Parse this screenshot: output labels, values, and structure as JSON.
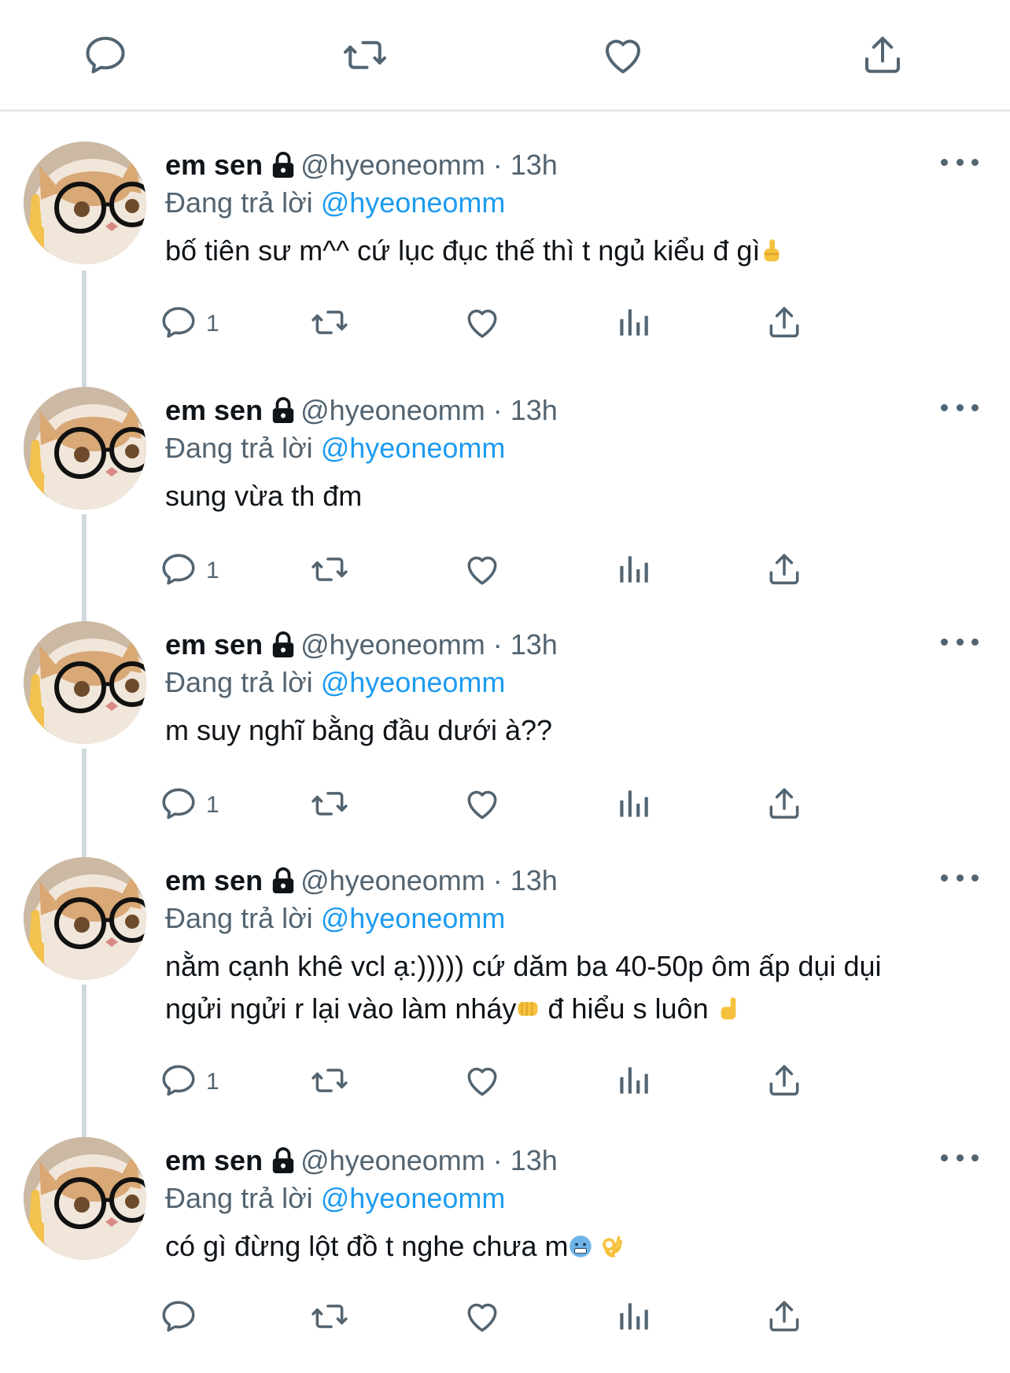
{
  "colors": {
    "text": "#0f1419",
    "secondary": "#536471",
    "accent": "#1d9bf0",
    "divider": "#e6e9ec",
    "thread_line": "#cfd9de"
  },
  "top_actions": [
    {
      "icon": "reply-icon"
    },
    {
      "icon": "retweet-icon"
    },
    {
      "icon": "like-icon"
    },
    {
      "icon": "share-icon"
    }
  ],
  "tweets": [
    {
      "name": "em sen",
      "handle": "@hyeoneomm",
      "separator": "·",
      "time": "13h",
      "replying_label": "Đang trả lời",
      "replying_to": "@hyeoneomm",
      "text_lines": [
        "bố tiên sư m^^ cứ lục đục thế thì t ngủ kiểu đ gì"
      ],
      "emojis": [
        "middle-finger-emoji"
      ],
      "reply_count": "1"
    },
    {
      "name": "em sen",
      "handle": "@hyeoneomm",
      "separator": "·",
      "time": "13h",
      "replying_label": "Đang trả lời",
      "replying_to": "@hyeoneomm",
      "text_lines": [
        "sung vừa th đm"
      ],
      "reply_count": "1"
    },
    {
      "name": "em sen",
      "handle": "@hyeoneomm",
      "separator": "·",
      "time": "13h",
      "replying_label": "Đang trả lời",
      "replying_to": "@hyeoneomm",
      "text_lines": [
        "m suy nghĩ bằng đầu dưới à??"
      ],
      "reply_count": "1"
    },
    {
      "name": "em sen",
      "handle": "@hyeoneomm",
      "separator": "·",
      "time": "13h",
      "replying_label": "Đang trả lời",
      "replying_to": "@hyeoneomm",
      "text_lines": [
        "nằm cạnh khê vcl ạ:))))) cứ dăm ba 40-50p ôm ấp dụi dụi",
        "ngửi ngửi r lại vào làm nháy",
        "đ hiểu s luôn"
      ],
      "emojis": [
        "punch-emoji",
        "pinky-finger-emoji"
      ],
      "reply_count": "1"
    },
    {
      "name": "em sen",
      "handle": "@hyeoneomm",
      "separator": "·",
      "time": "13h",
      "replying_label": "Đang trả lời",
      "replying_to": "@hyeoneomm",
      "text_lines": [
        "có gì đừng lột đồ t nghe chưa m"
      ],
      "emojis": [
        "freezing-face-emoji",
        "ok-hand-emoji"
      ],
      "reply_count": ""
    }
  ]
}
